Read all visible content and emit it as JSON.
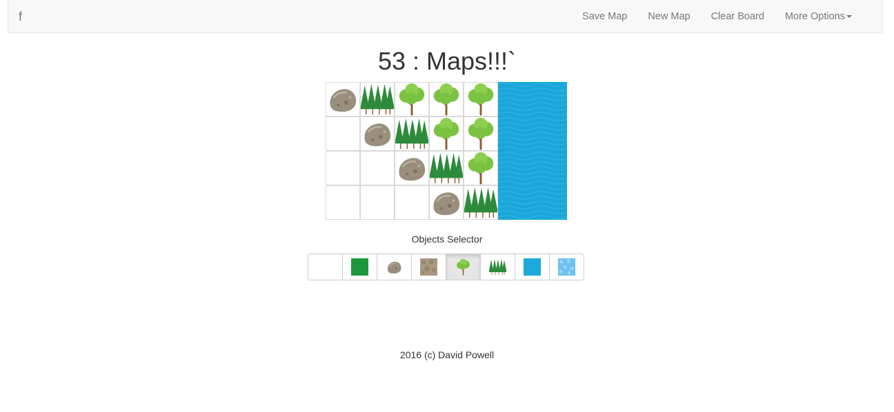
{
  "navbar": {
    "brand": "f",
    "links": [
      {
        "label": "Save Map"
      },
      {
        "label": "New Map"
      },
      {
        "label": "Clear Board"
      },
      {
        "label": "More Options"
      }
    ]
  },
  "title": "53 : Maps!!!`",
  "board": {
    "rows": 4,
    "cols": 7,
    "tiles": [
      [
        "rock",
        "pines",
        "tree",
        "tree",
        "tree",
        "water",
        "water"
      ],
      [
        "empty",
        "rock",
        "pines",
        "tree",
        "tree",
        "water",
        "water"
      ],
      [
        "empty",
        "empty",
        "rock",
        "pines",
        "tree",
        "water",
        "water"
      ],
      [
        "empty",
        "empty",
        "empty",
        "rock",
        "pines",
        "water",
        "water"
      ]
    ]
  },
  "selector": {
    "label": "Objects Selector",
    "options": [
      "empty",
      "grass",
      "rock",
      "dirt",
      "tree",
      "pines",
      "water",
      "water-light"
    ],
    "selected": "tree"
  },
  "footer": "2016 (c) David Powell",
  "colors": {
    "water": "#1aa6d8",
    "water_light": "#6cc2ef",
    "grass": "#1e9a3e",
    "tree_leaf": "#7cc242",
    "pine": "#2e8b3c",
    "rock": "#9a8f7d",
    "trunk": "#8b5a2b"
  }
}
